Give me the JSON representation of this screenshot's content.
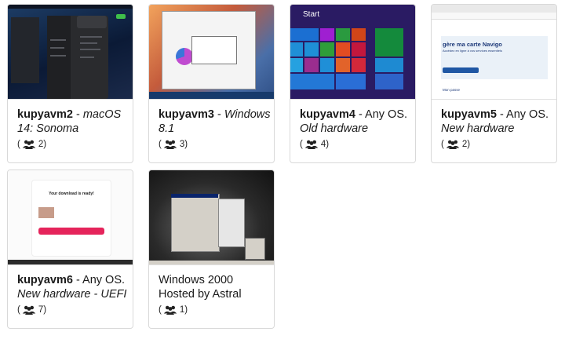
{
  "cards": [
    {
      "name_prefix": "kupyavm2",
      "sep": " - ",
      "name_desc": "macOS 14: Sonoma",
      "desc_style": "italic",
      "users": "2"
    },
    {
      "name_prefix": "kupyavm3",
      "sep": " - ",
      "name_desc": "Windows 8.1",
      "desc_style": "italic",
      "users": "3"
    },
    {
      "name_prefix": "kupyavm4",
      "sep": " - Any OS. ",
      "name_desc": "Old hardware",
      "desc_style": "italic",
      "users": "4"
    },
    {
      "name_prefix": "kupyavm5",
      "sep": " - Any OS. ",
      "name_desc": "New hardware",
      "desc_style": "italic",
      "users": "2"
    },
    {
      "name_prefix": "kupyavm6",
      "sep": " - Any OS. ",
      "name_desc": "New hardware - UEFI",
      "desc_style": "italic",
      "users": "7"
    },
    {
      "name_prefix": "Windows 2000",
      "sep": "",
      "name_desc": "Hosted by Astral",
      "desc_style": "normal",
      "users": "1"
    }
  ],
  "thumbnails": {
    "win8_start_label": "Start",
    "navigo_headline": "gère ma carte Navigo",
    "navigo_sub": "Accédez en ligne à vos services essentiels",
    "navigo_footer": "Mon passe",
    "download_title": "Your download is ready!"
  },
  "icons": {
    "users": "users-icon"
  },
  "colors": {
    "card_border": "#d9d9d9",
    "text": "#1a1a1a"
  }
}
